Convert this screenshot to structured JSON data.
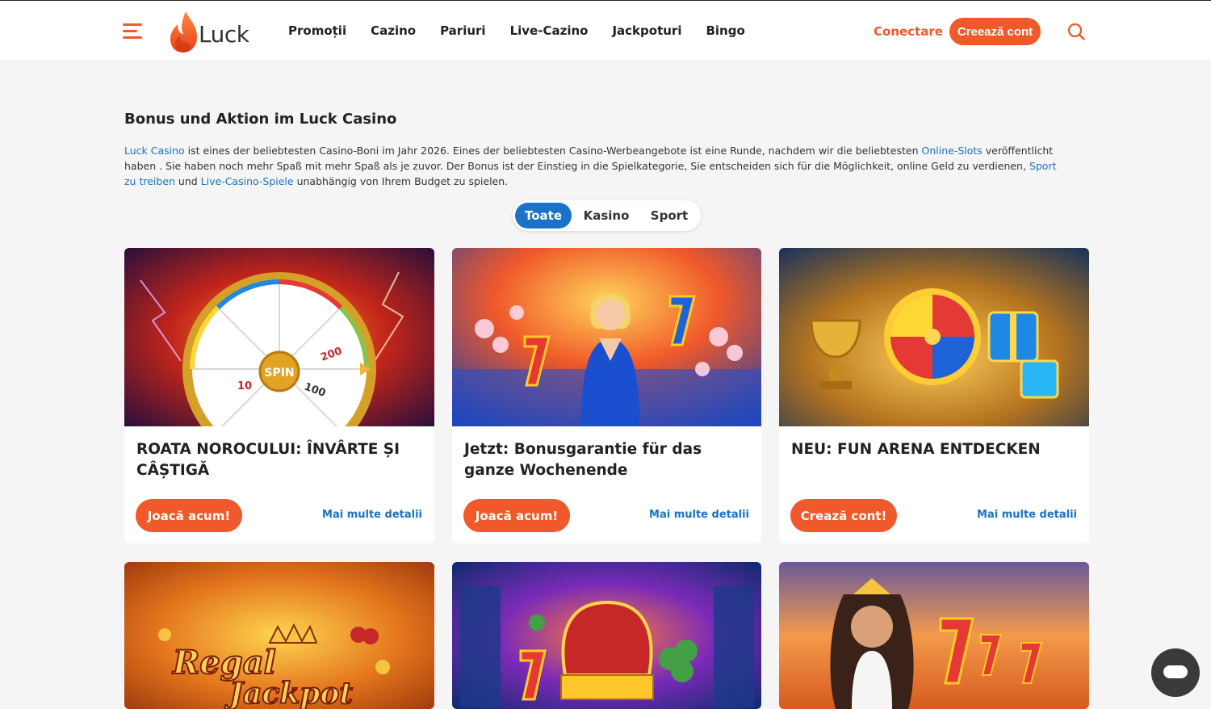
{
  "header": {
    "logo_text": "Luck",
    "nav": [
      "Promoții",
      "Cazino",
      "Pariuri",
      "Live-Cazino",
      "Jackpoturi",
      "Bingo"
    ],
    "login_label": "Conectare",
    "signup_label": "Creează cont"
  },
  "main": {
    "title": "Bonus und Aktion im Luck Casino",
    "intro": {
      "link1": "Luck Casino",
      "text1": " ist eines der beliebtesten Casino-Boni im Jahr 2026. Eines der beliebtesten Casino-Werbeangebote ist eine Runde, nachdem wir die beliebtesten ",
      "link2": "Online-Slots",
      "text2": " veröffentlicht haben . Sie haben noch mehr Spaß mit mehr Spaß als je zuvor. Der Bonus ist der Einstieg in die Spielkategorie, Sie entscheiden sich für die Möglichkeit, online Geld zu verdienen, ",
      "link3": "Sport zu treiben",
      "text3": " und ",
      "link4": "Live-Casino-Spiele",
      "text4": " unabhängig von Ihrem Budget zu spielen."
    },
    "filters": [
      "Toate",
      "Kasino",
      "Sport"
    ],
    "cards": [
      {
        "title": "ROATA NOROCULUI: ÎNVÂRTE ȘI CÂȘTIGĂ",
        "cta": "Joacă acum!",
        "more": "Mai multe detalii"
      },
      {
        "title": "Jetzt: Bonusgarantie für das ganze Wochenende",
        "cta": "Joacă acum!",
        "more": "Mai multe detalii"
      },
      {
        "title": "NEU: FUN ARENA ENTDECKEN",
        "cta": "Crează cont!",
        "more": "Mai multe detalii"
      },
      {
        "image_text_1": "Regal",
        "image_text_2": "Jackpot"
      },
      {},
      {}
    ]
  },
  "wheel_labels": [
    "SPIN",
    "200",
    "100",
    "10"
  ],
  "colors": {
    "brand": "#f0592a",
    "link": "#1a73c8"
  }
}
